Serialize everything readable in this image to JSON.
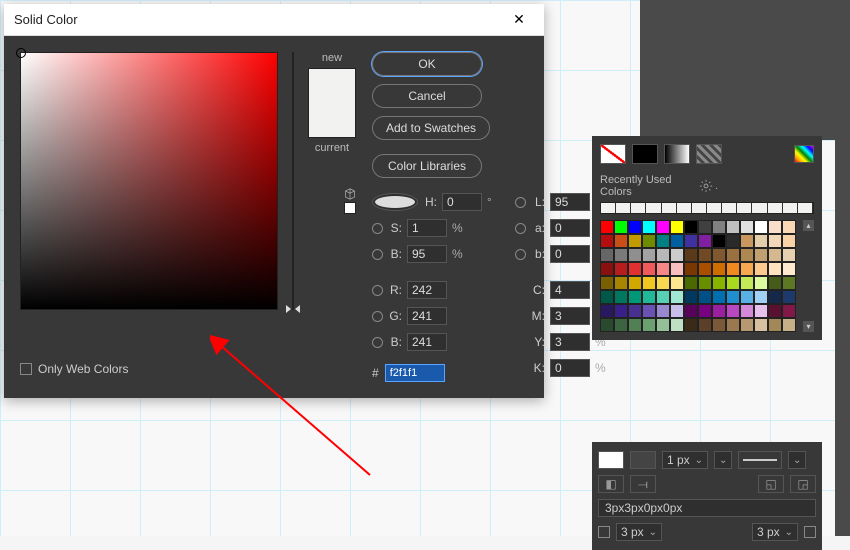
{
  "dialog": {
    "title": "Solid Color",
    "new_label": "new",
    "current_label": "current",
    "buttons": {
      "ok": "OK",
      "cancel": "Cancel",
      "add_swatches": "Add to Swatches",
      "color_libraries": "Color Libraries"
    },
    "hsb": {
      "H": "0",
      "S": "1",
      "B": "95"
    },
    "lab": {
      "L": "95",
      "a": "0",
      "b": "0"
    },
    "rgb": {
      "R": "242",
      "G": "241",
      "B": "241"
    },
    "cmyk": {
      "C": "4",
      "M": "3",
      "Y": "3",
      "K": "0"
    },
    "hex": "f2f1f1",
    "deg": "°",
    "pct": "%",
    "web_colors_label": "Only Web Colors",
    "hash": "#"
  },
  "swatches_panel": {
    "recent_label": "Recently Used Colors",
    "rows": [
      [
        "#ff0000",
        "#00ff00",
        "#0000ff",
        "#00ffff",
        "#ff00ff",
        "#ffff00",
        "#000000",
        "#404040",
        "#808080",
        "#c0c0c0",
        "#e0e0e0",
        "#ffffff",
        "#f8decb",
        "#fad7b5"
      ],
      [
        "#b50e0e",
        "#c84f17",
        "#c29b00",
        "#6f8c00",
        "#008080",
        "#005f9e",
        "#4030a0",
        "#8020a0",
        "#000000",
        "#2a2a2a",
        "#c89860",
        "#e4cfad",
        "#f0d8b8",
        "#fad2a8"
      ],
      [
        "#666666",
        "#7a7a7a",
        "#8f8f8f",
        "#a3a3a3",
        "#b8b8b8",
        "#cccccc",
        "#5a3a1a",
        "#6f4a25",
        "#7f5830",
        "#9a7040",
        "#ad8850",
        "#c0a070",
        "#d4b890",
        "#e6d0b0"
      ],
      [
        "#8a0f0f",
        "#b81d1d",
        "#e03030",
        "#f05a5a",
        "#f88888",
        "#fac0c0",
        "#7a3800",
        "#a85000",
        "#d06d00",
        "#f08a20",
        "#f7a850",
        "#fcc990",
        "#ffe2c0",
        "#ffe9d0"
      ],
      [
        "#7a6000",
        "#a88500",
        "#d0a800",
        "#f0c820",
        "#f8d850",
        "#fde890",
        "#4a6a00",
        "#688f00",
        "#88b400",
        "#a8d820",
        "#c4e858",
        "#defaa0",
        "#465a1a",
        "#5c7824"
      ],
      [
        "#005848",
        "#007860",
        "#009878",
        "#20b898",
        "#58d0b4",
        "#a0e8d4",
        "#003860",
        "#005088",
        "#006fb0",
        "#208fd0",
        "#58b0e4",
        "#a0d0f4",
        "#14284a",
        "#1d3a6a"
      ],
      [
        "#281860",
        "#382088",
        "#483090",
        "#6a52b4",
        "#9888d0",
        "#c8c0ea",
        "#58005a",
        "#780080",
        "#9a20a0",
        "#b848c0",
        "#d488d8",
        "#e8c0ec",
        "#5a1030",
        "#801848"
      ],
      [
        "#2a4a30",
        "#3c6440",
        "#508054",
        "#6ca070",
        "#94c098",
        "#c0e0c4",
        "#3a2a18",
        "#5a4028",
        "#7a5838",
        "#9a7850",
        "#b89870",
        "#d6c0a0",
        "#a08858",
        "#c6b088"
      ]
    ]
  },
  "stroke_controls": {
    "width": "1 px",
    "radius_str": "3px3px0px0px",
    "r_left": "3 px",
    "r_right": "3 px"
  }
}
